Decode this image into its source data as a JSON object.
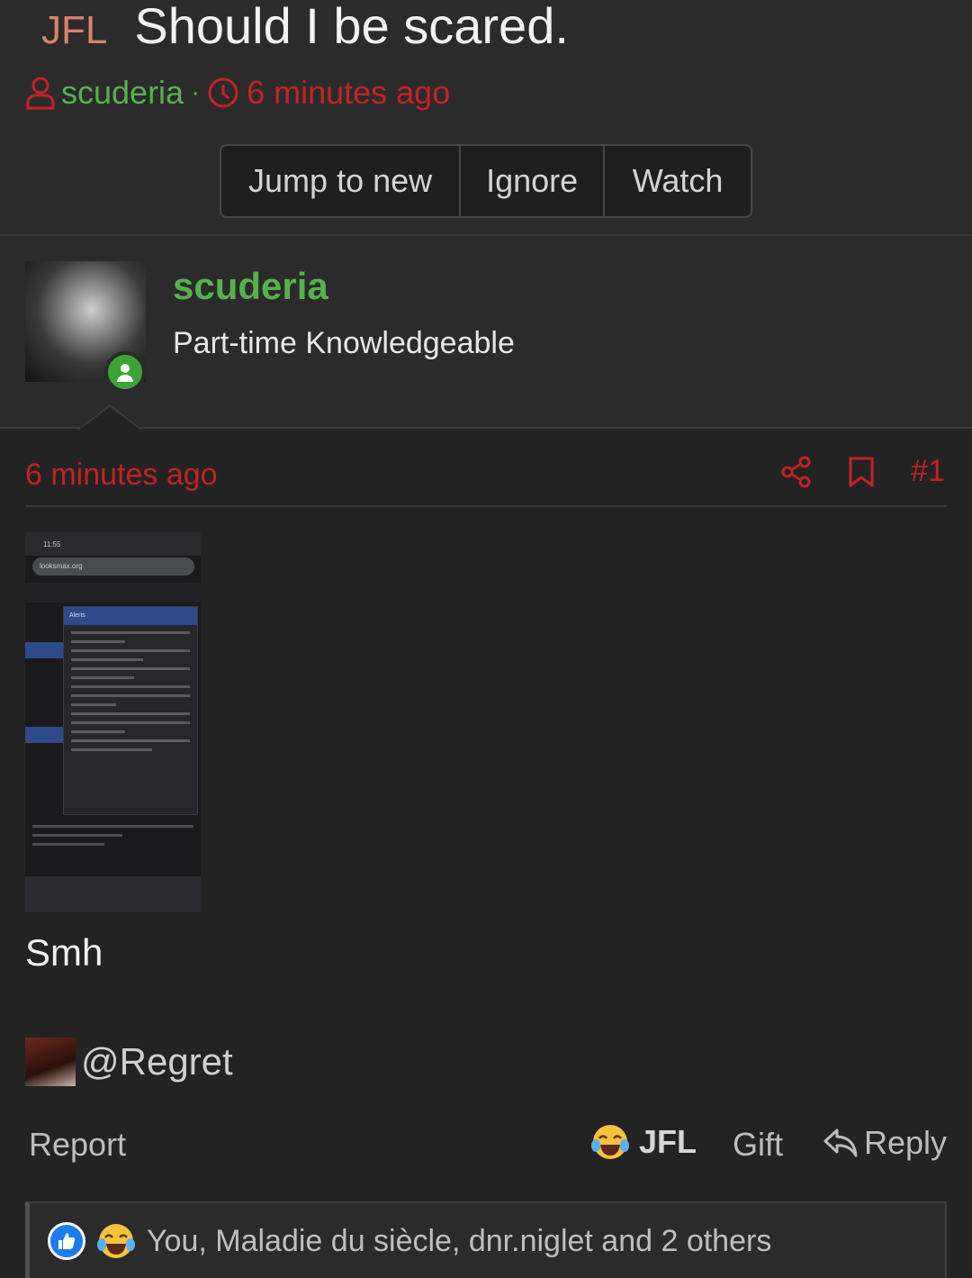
{
  "thread": {
    "prefix": "JFL",
    "title": "Should I be scared.",
    "author": "scuderia",
    "time": "6 minutes ago",
    "buttons": [
      "Jump to new",
      "Ignore",
      "Watch"
    ]
  },
  "user": {
    "name": "scuderia",
    "title": "Part-time Knowledgeable",
    "status": "online"
  },
  "post": {
    "time": "6 minutes ago",
    "number": "#1",
    "attachment_alt": "screenshot",
    "attachment": {
      "clock": "11:55",
      "url": "looksmax.org",
      "alerts_header": "Alerts"
    },
    "body": "Smh",
    "mention": "@Regret"
  },
  "actions": {
    "report": "Report",
    "reaction_label": "JFL",
    "gift": "Gift",
    "reply": "Reply"
  },
  "reactions": {
    "summary": "You, Maladie du siècle, dnr.niglet and 2 others"
  },
  "colors": {
    "background": "#232323",
    "panel": "#2b2b2b",
    "username_green": "#56b14d",
    "time_red": "#c22323",
    "prefix_orange": "#d9826a"
  }
}
